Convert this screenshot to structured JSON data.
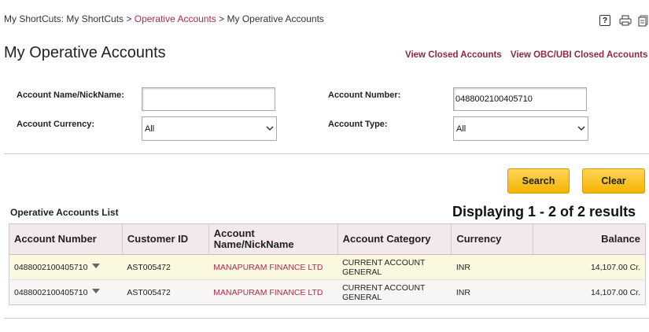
{
  "breadcrumb": {
    "part1": "My ShortCuts: My ShortCuts",
    "sep": ">",
    "link": "Operative Accounts",
    "current": "My Operative Accounts"
  },
  "tools": {
    "help": "?"
  },
  "page_title": "My Operative Accounts",
  "links": {
    "view_closed": "View Closed Accounts",
    "view_obc": "View OBC/UBI Closed Accounts"
  },
  "form": {
    "name_label": "Account Name/NickName:",
    "name_value": "",
    "number_label": "Account Number:",
    "number_value": "0488002100405710",
    "currency_label": "Account Currency:",
    "currency_value": "All",
    "type_label": "Account Type:",
    "type_value": "All"
  },
  "buttons": {
    "search": "Search",
    "clear": "Clear"
  },
  "list": {
    "label": "Operative Accounts List",
    "displaying": "Displaying 1 - 2 of 2 results",
    "headers": [
      "Account Number",
      "Customer ID",
      "Account Name/NickName",
      "Account Category",
      "Currency",
      "Balance"
    ],
    "rows": [
      {
        "number": "0488002100405710",
        "customer": "AST005472",
        "name": "MANAPURAM FINANCE LTD",
        "category": "CURRENT ACCOUNT GENERAL",
        "currency": "INR",
        "balance": "14,107.00 Cr."
      },
      {
        "number": "0488002100405710",
        "customer": "AST005472",
        "name": "MANAPURAM FINANCE LTD",
        "category": "CURRENT ACCOUNT GENERAL",
        "currency": "INR",
        "balance": "14,107.00 Cr."
      }
    ]
  },
  "colors": {
    "accent": "#a1304e",
    "button": "#f5b400",
    "header_bg": "#f4e9ea",
    "row_highlight": "#fbf8e0"
  }
}
